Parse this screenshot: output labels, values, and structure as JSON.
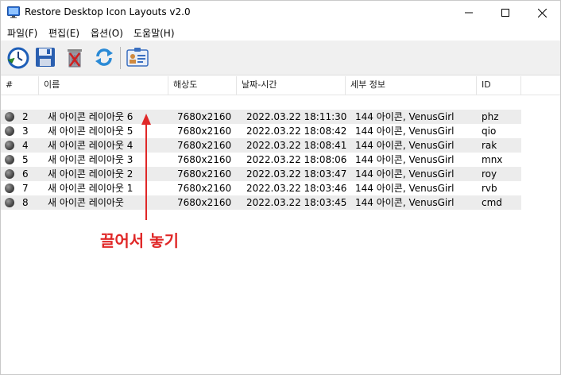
{
  "window": {
    "title": "Restore Desktop Icon Layouts v2.0"
  },
  "menu": [
    "파일(F)",
    "편집(E)",
    "옵션(O)",
    "도움말(H)"
  ],
  "toolbar": {
    "icons": [
      "restore-clock-icon",
      "save-floppy-icon",
      "delete-trash-icon",
      "refresh-icon",
      "properties-card-icon"
    ]
  },
  "columns": [
    "#",
    "이름",
    "해상도",
    "날짜-시간",
    "세부 정보",
    "ID"
  ],
  "rows": [
    {
      "num": "2",
      "name": "새 아이콘 레이아웃 6",
      "res": "7680x2160",
      "datetime": "2022.03.22 18:11:30",
      "detail": "144 아이콘, VenusGirl",
      "id": "phz"
    },
    {
      "num": "3",
      "name": "새 아이콘 레이아웃 5",
      "res": "7680x2160",
      "datetime": "2022.03.22 18:08:42",
      "detail": "144 아이콘, VenusGirl",
      "id": "qio"
    },
    {
      "num": "4",
      "name": "새 아이콘 레이아웃 4",
      "res": "7680x2160",
      "datetime": "2022.03.22 18:08:41",
      "detail": "144 아이콘, VenusGirl",
      "id": "rak"
    },
    {
      "num": "5",
      "name": "새 아이콘 레이아웃 3",
      "res": "7680x2160",
      "datetime": "2022.03.22 18:08:06",
      "detail": "144 아이콘, VenusGirl",
      "id": "mnx"
    },
    {
      "num": "6",
      "name": "새 아이콘 레이아웃 2",
      "res": "7680x2160",
      "datetime": "2022.03.22 18:03:47",
      "detail": "144 아이콘, VenusGirl",
      "id": "roy"
    },
    {
      "num": "7",
      "name": "새 아이콘 레이아웃 1",
      "res": "7680x2160",
      "datetime": "2022.03.22 18:03:46",
      "detail": "144 아이콘, VenusGirl",
      "id": "rvb"
    },
    {
      "num": "8",
      "name": "새 아이콘 레이아웃",
      "res": "7680x2160",
      "datetime": "2022.03.22 18:03:45",
      "detail": "144 아이콘, VenusGirl",
      "id": "cmd"
    }
  ],
  "annotation": {
    "text": "끌어서 놓기",
    "color": "#e02828"
  }
}
